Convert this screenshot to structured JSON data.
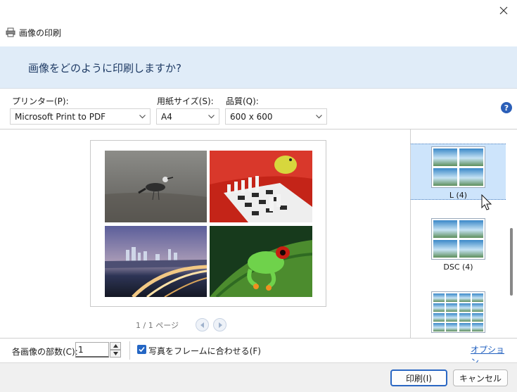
{
  "window": {
    "title": "画像の印刷",
    "icons": {
      "close": "close-icon",
      "app": "printer-icon"
    }
  },
  "banner": {
    "heading": "画像をどのように印刷しますか?"
  },
  "settings": {
    "printer_label": "プリンター(P):",
    "printer_value": "Microsoft Print to PDF",
    "paper_label": "用紙サイズ(S):",
    "paper_value": "A4",
    "quality_label": "品質(Q):",
    "quality_value": "600 x 600",
    "help_glyph": "?"
  },
  "preview": {
    "page_indicator": "1 / 1 ページ",
    "photos": [
      "seagull-photo",
      "chess-parrot-photo",
      "city-night-photo",
      "frog-photo"
    ]
  },
  "layouts": {
    "items": [
      {
        "label": "L (4)",
        "selected": true
      },
      {
        "label": "DSC (4)",
        "selected": false
      },
      {
        "label": "",
        "selected": false
      }
    ]
  },
  "copies": {
    "label": "各画像の部数(C):",
    "value": "1"
  },
  "fit": {
    "label": "写真をフレームに合わせる(F)",
    "checked": true
  },
  "options_link": "オプション...",
  "footer": {
    "print_label": "印刷(I)",
    "cancel_label": "キャンセル"
  },
  "colors": {
    "accent": "#2466c4",
    "banner": "#e0ecf8"
  }
}
